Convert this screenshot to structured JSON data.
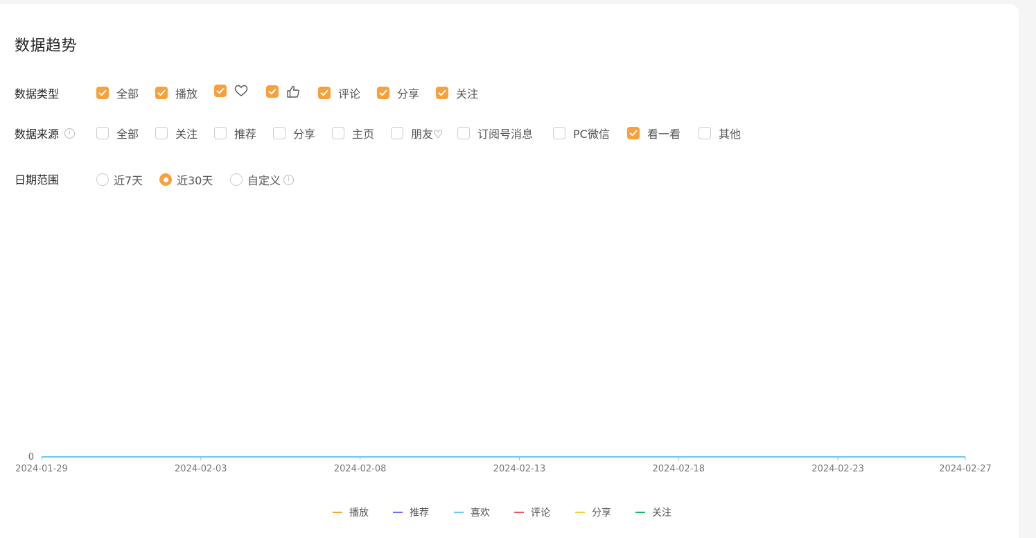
{
  "section_title": "数据趋势",
  "data_type": {
    "label": "数据类型",
    "options": [
      {
        "label": "全部",
        "checked": true
      },
      {
        "label": "播放",
        "checked": true
      },
      {
        "label": "",
        "icon": "heart-icon",
        "checked": true
      },
      {
        "label": "",
        "icon": "thumbs-up-icon",
        "checked": true
      },
      {
        "label": "评论",
        "checked": true
      },
      {
        "label": "分享",
        "checked": true
      },
      {
        "label": "关注",
        "checked": true
      }
    ]
  },
  "data_source": {
    "label": "数据来源",
    "info_icon": "info-icon",
    "options": [
      {
        "label": "全部",
        "checked": false
      },
      {
        "label": "关注",
        "checked": false
      },
      {
        "label": "推荐",
        "checked": false
      },
      {
        "label": "分享",
        "checked": false
      },
      {
        "label": "主页",
        "checked": false
      },
      {
        "label": "朋友♡",
        "checked": false
      },
      {
        "label": "订阅号消息",
        "checked": false
      },
      {
        "label": "PC微信",
        "checked": false
      },
      {
        "label": "看一看",
        "checked": true
      },
      {
        "label": "其他",
        "checked": false
      }
    ]
  },
  "date_range": {
    "label": "日期范围",
    "options": [
      {
        "label": "近7天",
        "selected": false
      },
      {
        "label": "近30天",
        "selected": true
      },
      {
        "label": "自定义",
        "selected": false,
        "info_icon": "info-icon"
      }
    ]
  },
  "colors": {
    "accent": "#f7a03c",
    "axis_line": "#6ec6f4"
  },
  "chart_data": {
    "type": "line",
    "x": [
      "2024-01-29",
      "2024-01-30",
      "2024-01-31",
      "2024-02-01",
      "2024-02-02",
      "2024-02-03",
      "2024-02-04",
      "2024-02-05",
      "2024-02-06",
      "2024-02-07",
      "2024-02-08",
      "2024-02-09",
      "2024-02-10",
      "2024-02-11",
      "2024-02-12",
      "2024-02-13",
      "2024-02-14",
      "2024-02-15",
      "2024-02-16",
      "2024-02-17",
      "2024-02-18",
      "2024-02-19",
      "2024-02-20",
      "2024-02-21",
      "2024-02-22",
      "2024-02-23",
      "2024-02-24",
      "2024-02-25",
      "2024-02-26",
      "2024-02-27"
    ],
    "x_tick_labels": [
      "2024-01-29",
      "2024-02-03",
      "2024-02-08",
      "2024-02-13",
      "2024-02-18",
      "2024-02-23",
      "2024-02-27"
    ],
    "y_tick_labels": [
      "0"
    ],
    "ylim": [
      0,
      0
    ],
    "grid": false,
    "legend_position": "bottom-center",
    "series": [
      {
        "name": "播放",
        "color": "#f7a03c",
        "values": [
          0,
          0,
          0,
          0,
          0,
          0,
          0,
          0,
          0,
          0,
          0,
          0,
          0,
          0,
          0,
          0,
          0,
          0,
          0,
          0,
          0,
          0,
          0,
          0,
          0,
          0,
          0,
          0,
          0,
          0
        ]
      },
      {
        "name": "推荐",
        "color": "#6b6bff",
        "values": [
          0,
          0,
          0,
          0,
          0,
          0,
          0,
          0,
          0,
          0,
          0,
          0,
          0,
          0,
          0,
          0,
          0,
          0,
          0,
          0,
          0,
          0,
          0,
          0,
          0,
          0,
          0,
          0,
          0,
          0
        ]
      },
      {
        "name": "喜欢",
        "color": "#6ec6f4",
        "values": [
          0,
          0,
          0,
          0,
          0,
          0,
          0,
          0,
          0,
          0,
          0,
          0,
          0,
          0,
          0,
          0,
          0,
          0,
          0,
          0,
          0,
          0,
          0,
          0,
          0,
          0,
          0,
          0,
          0,
          0
        ]
      },
      {
        "name": "评论",
        "color": "#f0545c",
        "values": [
          0,
          0,
          0,
          0,
          0,
          0,
          0,
          0,
          0,
          0,
          0,
          0,
          0,
          0,
          0,
          0,
          0,
          0,
          0,
          0,
          0,
          0,
          0,
          0,
          0,
          0,
          0,
          0,
          0,
          0
        ]
      },
      {
        "name": "分享",
        "color": "#f9c74f",
        "values": [
          0,
          0,
          0,
          0,
          0,
          0,
          0,
          0,
          0,
          0,
          0,
          0,
          0,
          0,
          0,
          0,
          0,
          0,
          0,
          0,
          0,
          0,
          0,
          0,
          0,
          0,
          0,
          0,
          0,
          0
        ]
      },
      {
        "name": "关注",
        "color": "#1cb463",
        "values": [
          0,
          0,
          0,
          0,
          0,
          0,
          0,
          0,
          0,
          0,
          0,
          0,
          0,
          0,
          0,
          0,
          0,
          0,
          0,
          0,
          0,
          0,
          0,
          0,
          0,
          0,
          0,
          0,
          0,
          0
        ]
      }
    ]
  }
}
